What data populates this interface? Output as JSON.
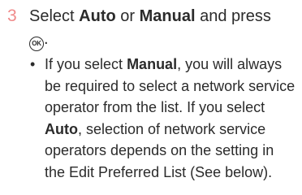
{
  "step": {
    "number": "3",
    "text_1": "Select ",
    "bold_auto": "Auto",
    "text_2": " or ",
    "bold_manual": "Manual",
    "text_3": " and press",
    "icon": "ok-button-icon",
    "icon_text": "OK",
    "text_4": "."
  },
  "bullet": {
    "symbol": "•",
    "text_1": "If you select ",
    "bold_manual": "Manual",
    "text_2": ", you will always be required to select a network service operator from the list. If you select ",
    "bold_auto": "Auto",
    "text_3": ", selection of network service operators depends on the setting in the Edit Preferred List (See below)."
  },
  "colors": {
    "step_number": "#f08a8a",
    "text": "#2b2b2b"
  }
}
